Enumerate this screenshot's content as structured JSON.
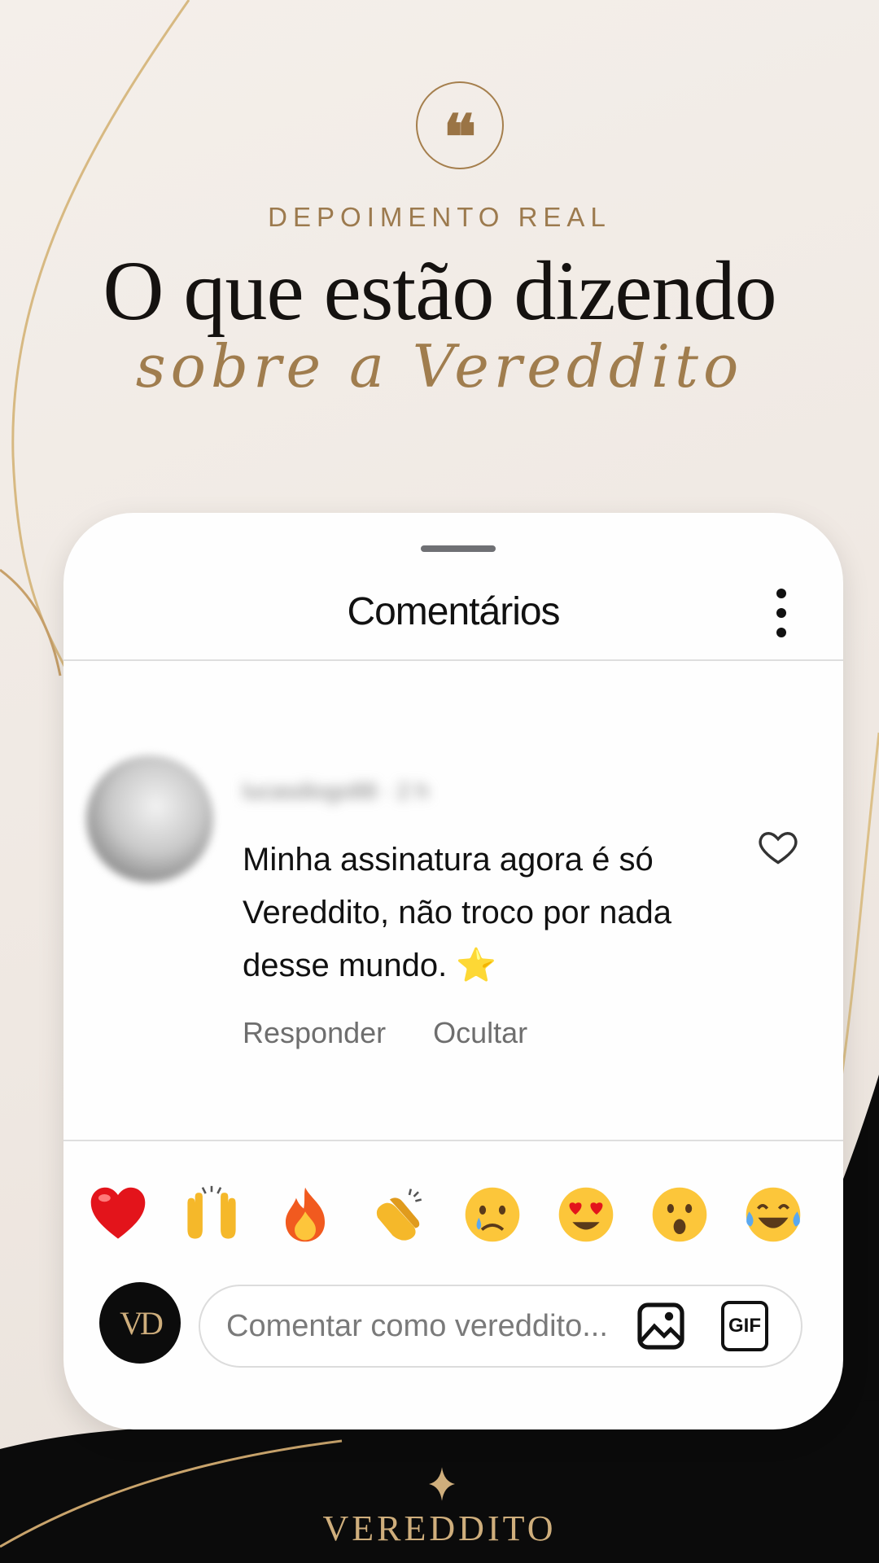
{
  "header": {
    "quote_glyph": "❝",
    "kicker": "DEPOIMENTO REAL",
    "title": "O que estão dizendo",
    "script_line": "sobre a Vereddito"
  },
  "card": {
    "title": "Comentários",
    "comment": {
      "text": "Minha assinatura agora é só Vereddito, não troco por nada desse mundo.",
      "emoji": "⭐",
      "reply_label": "Responder",
      "hide_label": "Ocultar"
    },
    "reactions": [
      "red-heart",
      "raising-hands",
      "fire",
      "clapping-hands",
      "crying-face",
      "heart-eyes-face",
      "astonished-face",
      "tears-of-joy-face"
    ],
    "composer": {
      "avatar_initials": "VD",
      "placeholder": "Comentar como vereddito...",
      "gif_label": "GIF"
    }
  },
  "footer": {
    "brand": "VEREDDITO"
  },
  "colors": {
    "gold": "#a07d4e",
    "black": "#0c0c0c",
    "background": "#f1ebe5"
  }
}
